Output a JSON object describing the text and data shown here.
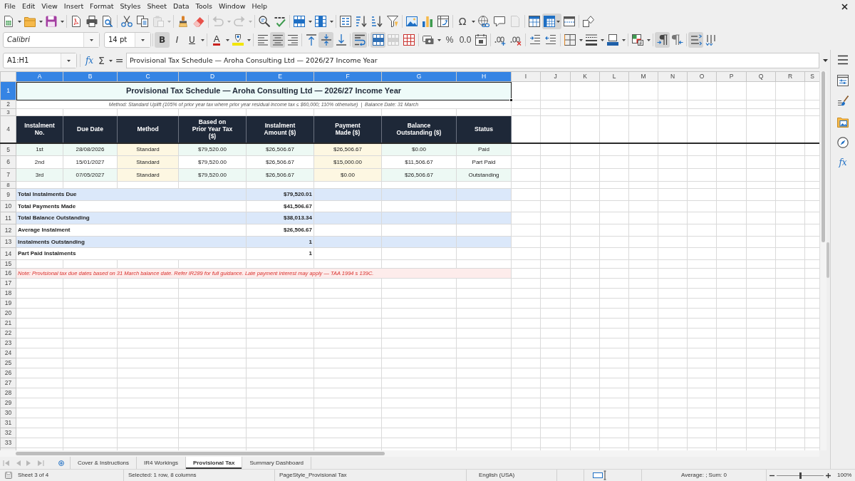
{
  "menu": [
    "File",
    "Edit",
    "View",
    "Insert",
    "Format",
    "Styles",
    "Sheet",
    "Data",
    "Tools",
    "Window",
    "Help"
  ],
  "standard_toolbar": {
    "paste_enabled": false,
    "undo_enabled": false,
    "redo_enabled": false,
    "special_character": "Ω",
    "header_footer_enabled": false,
    "freeze_rows_and_columns": true
  },
  "formatting_toolbar": {
    "font_name": "Calibri",
    "font_size": "14 pt",
    "style_buttons": [
      {
        "kind": "bold",
        "label": "B",
        "on": true
      },
      {
        "kind": "italic",
        "label": "I",
        "on": false
      },
      {
        "kind": "underline",
        "label": "U",
        "on": false
      }
    ],
    "font_color": "A",
    "align_left": false,
    "align_center": true,
    "align_right": false,
    "align_top": false,
    "align_middle": true,
    "align_bottom": false,
    "wrap_text": true,
    "merge_and_center": true,
    "merge_cells_enabled": false,
    "percent": "%",
    "number_format": "0.0",
    "left_to_right": true,
    "right_to_left": false,
    "text_direction_horizontal": true,
    "text_direction_vertical": false
  },
  "formula_bar": {
    "name_box": "A1:H1",
    "function_wizard": "fx",
    "sum": "Σ",
    "equals": "=",
    "content": "Provisional Tax Schedule — Aroha Consulting Ltd — 2026/27 Income Year"
  },
  "sheet": {
    "columns": [
      {
        "label": "A",
        "selected": true
      },
      {
        "label": "B",
        "selected": true
      },
      {
        "label": "C",
        "selected": true
      },
      {
        "label": "D",
        "selected": true
      },
      {
        "label": "E",
        "selected": true
      },
      {
        "label": "F",
        "selected": true
      },
      {
        "label": "G",
        "selected": true
      },
      {
        "label": "H",
        "selected": true
      },
      {
        "label": "I",
        "selected": false
      },
      {
        "label": "J",
        "selected": false
      },
      {
        "label": "K",
        "selected": false
      },
      {
        "label": "L",
        "selected": false
      },
      {
        "label": "M",
        "selected": false
      },
      {
        "label": "N",
        "selected": false
      },
      {
        "label": "O",
        "selected": false
      },
      {
        "label": "P",
        "selected": false
      },
      {
        "label": "Q",
        "selected": false
      },
      {
        "label": "R",
        "selected": false
      },
      {
        "label": "S",
        "selected": false
      }
    ],
    "row_headers": [
      {
        "label": "1",
        "selected": true
      },
      {
        "label": "2",
        "selected": false
      },
      {
        "label": "3",
        "selected": false
      },
      {
        "label": "4",
        "selected": false
      },
      {
        "label": "5",
        "selected": false
      },
      {
        "label": "6",
        "selected": false
      },
      {
        "label": "7",
        "selected": false
      },
      {
        "label": "8",
        "selected": false
      },
      {
        "label": "9",
        "selected": false
      },
      {
        "label": "10",
        "selected": false
      },
      {
        "label": "11",
        "selected": false
      },
      {
        "label": "12",
        "selected": false
      },
      {
        "label": "13",
        "selected": false
      },
      {
        "label": "14",
        "selected": false
      },
      {
        "label": "15",
        "selected": false
      },
      {
        "label": "16",
        "selected": false
      },
      {
        "label": "17",
        "selected": false
      },
      {
        "label": "18",
        "selected": false
      },
      {
        "label": "19",
        "selected": false
      },
      {
        "label": "20",
        "selected": false
      },
      {
        "label": "21",
        "selected": false
      },
      {
        "label": "22",
        "selected": false
      },
      {
        "label": "23",
        "selected": false
      },
      {
        "label": "24",
        "selected": false
      },
      {
        "label": "25",
        "selected": false
      },
      {
        "label": "26",
        "selected": false
      },
      {
        "label": "27",
        "selected": false
      },
      {
        "label": "28",
        "selected": false
      },
      {
        "label": "29",
        "selected": false
      },
      {
        "label": "30",
        "selected": false
      },
      {
        "label": "31",
        "selected": false
      },
      {
        "label": "32",
        "selected": false
      },
      {
        "label": "33",
        "selected": false
      }
    ],
    "title": "Provisional Tax Schedule — Aroha Consulting Ltd — 2026/27 Income Year",
    "method_note": "Method: Standard Uplift (105% of prior year tax where prior year residual income tax ≤ $60,000; 110% otherwise)  |  Balance Date: 31 March",
    "table_header": [
      "Instalment\nNo.",
      "Due Date",
      "Method",
      "Based on\nPrior Year Tax\n($)",
      "Instalment\nAmount ($)",
      "Payment\nMade ($)",
      "Balance\nOutstanding ($)",
      "Status"
    ],
    "instalments": [
      {
        "instalment": "1st",
        "due_date": "28/08/2026",
        "method": "Standard",
        "prior_year_tax": "$79,520.00",
        "instalment_amount": "$26,506.67",
        "payment_made": "$26,506.67",
        "balance_outstanding": "$0.00",
        "status": "Paid"
      },
      {
        "instalment": "2nd",
        "due_date": "15/01/2027",
        "method": "Standard",
        "prior_year_tax": "$79,520.00",
        "instalment_amount": "$26,506.67",
        "payment_made": "$15,000.00",
        "balance_outstanding": "$11,506.67",
        "status": "Part Paid"
      },
      {
        "instalment": "3rd",
        "due_date": "07/05/2027",
        "method": "Standard",
        "prior_year_tax": "$79,520.00",
        "instalment_amount": "$26,506.67",
        "payment_made": "$0.00",
        "balance_outstanding": "$26,506.67",
        "status": "Outstanding"
      }
    ],
    "summary": [
      {
        "label": "Total Instalments Due",
        "value": "$79,520.01"
      },
      {
        "label": "Total Payments Made",
        "value": "$41,506.67"
      },
      {
        "label": "Total Balance Outstanding",
        "value": "$38,013.34"
      },
      {
        "label": "Average Instalment",
        "value": "$26,506.67"
      },
      {
        "label": "Instalments Outstanding",
        "value": "1"
      },
      {
        "label": "Part Paid Instalments",
        "value": "1"
      }
    ],
    "footnote": "Note: Provisional tax due dates based on 31 March balance date. Refer IR289 for full guidance. Late payment interest may apply — TAA 1994 s 139C."
  },
  "sheet_tab_bar": {
    "navigation_enabled": false,
    "tabs": [
      {
        "label": "Cover & Instructions",
        "selected": false
      },
      {
        "label": "IR4 Workings",
        "selected": false
      },
      {
        "label": "Provisional Tax",
        "selected": true
      },
      {
        "label": "Summary Dashboard",
        "selected": false
      }
    ]
  },
  "sidebar": {
    "functions": "fx"
  },
  "status_bar": {
    "sheet_position": "Sheet 3 of 4",
    "selection": "Selected: 1 row, 8 columns",
    "page_style": "PageStyle_Provisional Tax",
    "language": "English (USA)",
    "statistics": "Average: ; Sum: 0",
    "zoom_slider": {
      "level": 0.5
    },
    "zoom": "100%"
  }
}
